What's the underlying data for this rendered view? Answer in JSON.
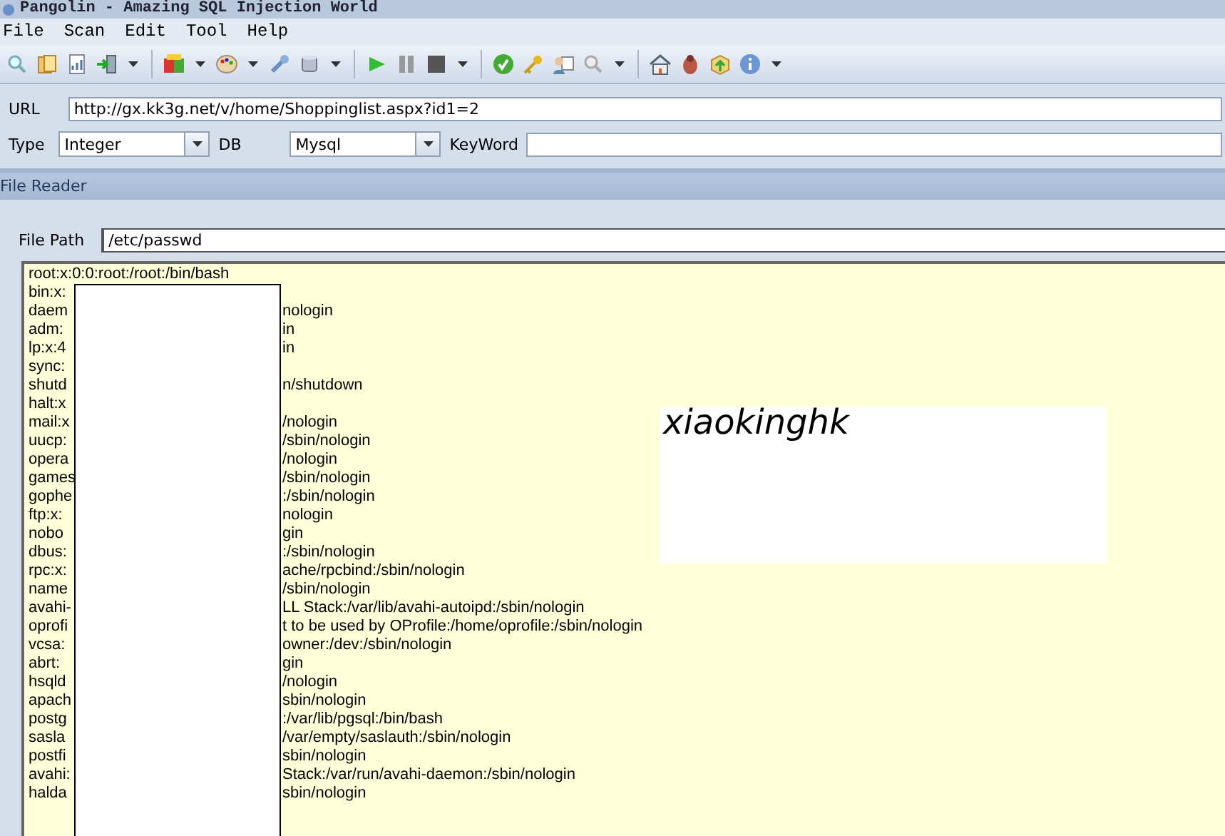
{
  "window": {
    "title": "Pangolin - Amazing SQL Injection World"
  },
  "menu": [
    "File",
    "Scan",
    "Edit",
    "Tool",
    "Help"
  ],
  "target": {
    "url_label": "URL",
    "url": "http://gx.kk3g.net/v/home/Shoppinglist.aspx?id1=2",
    "type_label": "Type",
    "type": "Integer",
    "db_label": "DB",
    "db": "Mysql",
    "keyword_label": "KeyWord"
  },
  "panel": {
    "title": "File Reader",
    "path_label": "File Path",
    "path": "/etc/passwd",
    "note": "xiaokinghk",
    "lines": [
      {
        "left": "root:x:0:0:root:/root:/bin/bash"
      },
      {
        "left": "bin:x:"
      },
      {
        "left": "daem",
        "right": "nologin"
      },
      {
        "left": "adm:",
        "right": "in"
      },
      {
        "left": "lp:x:4",
        "right": "in"
      },
      {
        "left": "sync:"
      },
      {
        "left": "shutd",
        "right": "n/shutdown"
      },
      {
        "left": "halt:x"
      },
      {
        "left": "mail:x",
        "right": "/nologin"
      },
      {
        "left": "uucp:",
        "right": "/sbin/nologin"
      },
      {
        "left": "opera",
        "right": "/nologin"
      },
      {
        "left": "games",
        "right": "/sbin/nologin"
      },
      {
        "left": "gophe",
        "right": ":/sbin/nologin"
      },
      {
        "left": "ftp:x:",
        "right": "nologin"
      },
      {
        "left": "nobo",
        "right": "gin"
      },
      {
        "left": "dbus:",
        "right": ":/sbin/nologin"
      },
      {
        "left": "rpc:x:",
        "right": "ache/rpcbind:/sbin/nologin"
      },
      {
        "left": "name",
        "right": "/sbin/nologin"
      },
      {
        "left": "avahi-",
        "right": "LL Stack:/var/lib/avahi-autoipd:/sbin/nologin"
      },
      {
        "left": "oprofi",
        "right": "t to be used by OProfile:/home/oprofile:/sbin/nologin"
      },
      {
        "left": "vcsa:",
        "right": "owner:/dev:/sbin/nologin"
      },
      {
        "left": "abrt:",
        "right": "gin"
      },
      {
        "left": "hsqld",
        "right": "/nologin"
      },
      {
        "left": "apach",
        "right": "sbin/nologin"
      },
      {
        "left": "postg",
        "right": ":/var/lib/pgsql:/bin/bash"
      },
      {
        "left": "sasla",
        "right": "/var/empty/saslauth:/sbin/nologin"
      },
      {
        "left": "postfi",
        "right": "sbin/nologin"
      },
      {
        "left": "avahi:",
        "right": "Stack:/var/run/avahi-daemon:/sbin/nologin"
      },
      {
        "left": "halda",
        "right": "sbin/nologin"
      }
    ]
  }
}
